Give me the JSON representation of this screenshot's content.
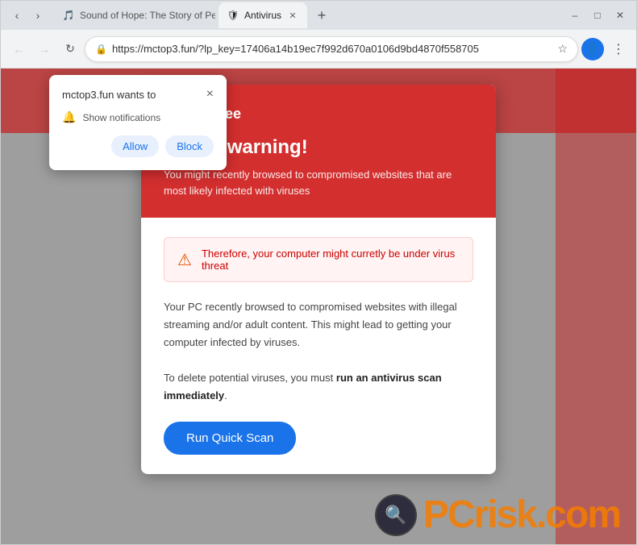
{
  "browser": {
    "tabs": [
      {
        "id": "tab1",
        "title": "Sound of Hope: The Story of Pe...",
        "active": false,
        "favicon": "🎵"
      },
      {
        "id": "tab2",
        "title": "Antivirus",
        "active": true,
        "favicon": "🛡"
      }
    ],
    "url": "https://mctop3.fun/?lp_key=17406a14b19ec7f992d670a0106d9bd4870f558705",
    "nav": {
      "back_disabled": true,
      "forward_disabled": true
    }
  },
  "notification_popup": {
    "title": "mctop3.fun wants to",
    "close_label": "×",
    "item_label": "Show notifications",
    "allow_label": "Allow",
    "block_label": "Block"
  },
  "scam_card": {
    "brand": "McAfee",
    "header_title": "Safety warning!",
    "header_subtitle": "You might recently browsed to compromised websites that are most likely infected with viruses",
    "warning_text": "Therefore, your computer might curretly be under virus threat",
    "body_text_1": "Your PC recently browsed to compromised websites with illegal streaming and/or adult content. This might lead to getting your computer infected by viruses.",
    "body_text_2": "To delete potential viruses, you must ",
    "body_text_bold": "run an antivirus scan immediately",
    "body_text_end": ".",
    "cta_label": "Run Quick Scan"
  },
  "watermark": {
    "icon": "🔍",
    "text_gray": "PC",
    "text_orange": "risk",
    "text_gray2": ".com"
  },
  "colors": {
    "red_header": "#d32f2f",
    "blue_cta": "#1a73e8",
    "warning_bg": "#fff3f3",
    "warning_border": "#ffcccc"
  }
}
